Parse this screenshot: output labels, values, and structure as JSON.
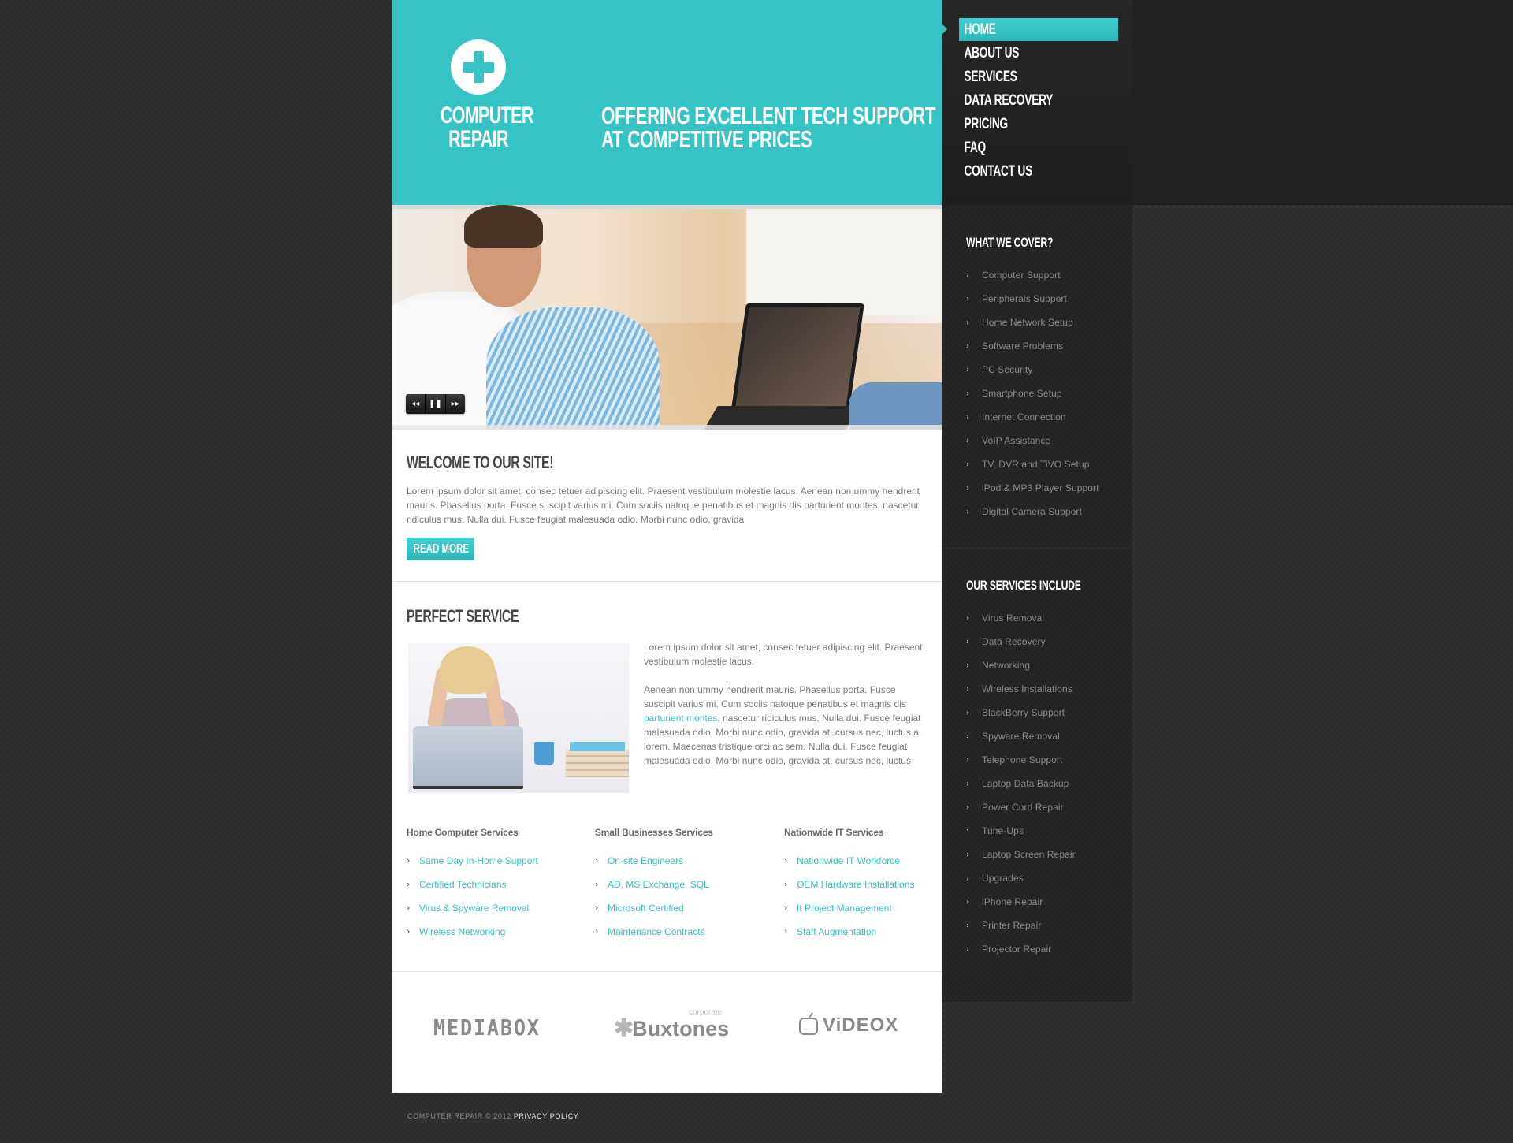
{
  "brand": {
    "name_line1": "COMPUTER",
    "name_line2": "REPAIR",
    "logo_icon": "plus-circle-icon",
    "accent_color": "#36c3c4"
  },
  "header": {
    "tagline_line1": "OFFERING EXCELLENT TECH SUPPORT",
    "tagline_line2": "AT COMPETITIVE PRICES"
  },
  "nav": {
    "items": [
      {
        "label": "HOME",
        "active": true
      },
      {
        "label": "ABOUT US",
        "active": false
      },
      {
        "label": "SERVICES",
        "active": false
      },
      {
        "label": "DATA RECOVERY",
        "active": false
      },
      {
        "label": "PRICING",
        "active": false
      },
      {
        "label": "FAQ",
        "active": false
      },
      {
        "label": "CONTACT US",
        "active": false
      }
    ]
  },
  "slider": {
    "prev_icon": "◂◂",
    "pause_icon": "❚❚",
    "next_icon": "▸▸"
  },
  "welcome": {
    "title": "WELCOME TO OUR SITE!",
    "text": "Lorem ipsum dolor sit amet, consec tetuer adipiscing elit. Praesent vestibulum molestie lacus. Aenean non ummy hendrerit mauris. Phasellus porta. Fusce suscipit varius mi. Cum sociis natoque penatibus et magnis dis parturient montes, nascetur ridiculus mus. Nulla dui. Fusce feugiat malesuada odio. Morbi nunc odio, gravida",
    "button_label": "READ MORE"
  },
  "perfect_service": {
    "title": "PERFECT SERVICE",
    "para1": "Lorem ipsum dolor sit amet, consec tetuer adipiscing elit. Praesent vestibulum molestie lacus.",
    "para2_before": "Aenean non ummy hendrerit mauris. Phasellus porta. Fusce suscipit varius mi. Cum sociis natoque penatibus et magnis dis ",
    "para2_link": "parturient montes",
    "para2_after": ", nascetur ridiculus mus. Nulla dui. Fusce feugiat malesuada odio. Morbi nunc odio, gravida at, cursus nec, luctus a, lorem. Maecenas tristique orci ac sem. Nulla dui. Fusce feugiat malesuada odio. Morbi nunc odio, gravida at, cursus nec, luctus"
  },
  "service_columns": [
    {
      "title": "Home Computer Services",
      "items": [
        "Same Day In-Home Support",
        "Certified Technicians",
        "Virus & Spyware Removal",
        "Wireless Networking"
      ]
    },
    {
      "title": "Small Businesses Services",
      "items": [
        "On-site Engineers",
        "AD, MS Exchange, SQL",
        "Microsoft Certified",
        "Maintenance Contracts"
      ]
    },
    {
      "title": "Nationwide IT Services",
      "items": [
        "Nationwide IT Workforce",
        "OEM Hardware Installations",
        "It Project Management",
        "Staff Augmentation"
      ]
    }
  ],
  "partners": {
    "mediabox": "MEDIABOX",
    "buxtones": "Buxtones",
    "buxtones_tag": "corporate",
    "videox": "ViDEOX"
  },
  "sidebar": {
    "what_we_cover": {
      "title": "WHAT WE COVER?",
      "items": [
        "Computer Support",
        "Peripherals Support",
        "Home Network Setup",
        "Software Problems",
        "PC Security",
        "Smartphone Setup",
        "Internet Connection",
        "VoIP Assistance",
        "TV, DVR and TiVO Setup",
        "iPod & MP3 Player Support",
        "Digital Camera Support"
      ]
    },
    "services_include": {
      "title": "OUR SERVICES INCLUDE",
      "items": [
        "Virus Removal",
        "Data Recovery",
        "Networking",
        "Wireless Installations",
        "BlackBerry Support",
        "Spyware Removal",
        "Telephone Support",
        "Laptop Data Backup",
        "Power Cord Repair",
        "Tune-Ups",
        "Laptop Screen Repair",
        "Upgrades",
        "iPhone Repair",
        "Printer Repair",
        "Projector Repair"
      ]
    }
  },
  "footer": {
    "copyright": "COMPUTER REPAIR © 2012",
    "privacy_link": "PRIVACY POLICY"
  }
}
